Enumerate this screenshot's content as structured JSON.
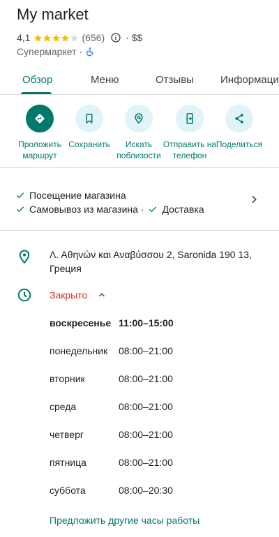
{
  "place": {
    "title": "My market",
    "rating": "4,1",
    "stars_value": 4.1,
    "stars_max": 5,
    "reviews": "(656)",
    "price": "· $$",
    "category": "Супермаркет ·"
  },
  "tabs": [
    {
      "label": "Обзор",
      "active": true
    },
    {
      "label": "Меню"
    },
    {
      "label": "Отзывы"
    },
    {
      "label": "Информация"
    }
  ],
  "actions": [
    {
      "label": "Проложить маршрут",
      "icon": "directions-icon"
    },
    {
      "label": "Сохранить",
      "icon": "bookmark-icon"
    },
    {
      "label": "Искать поблизости",
      "icon": "search-nearby-icon"
    },
    {
      "label": "Отправить на телефон",
      "icon": "send-to-phone-icon"
    },
    {
      "label": "Поделиться",
      "icon": "share-icon"
    }
  ],
  "services": {
    "line1": "Посещение магазина",
    "line2_a": "Самовывоз из магазина ·",
    "line2_b": "Доставка"
  },
  "address": "Λ. Αθηνών και Αναβύσσου 2, Saronida 190 13, Греция",
  "status": "Закрыто",
  "hours": [
    {
      "day": "воскресенье",
      "time": "11:00–15:00",
      "today": true
    },
    {
      "day": "понедельник",
      "time": "08:00–21:00"
    },
    {
      "day": "вторник",
      "time": "08:00–21:00"
    },
    {
      "day": "среда",
      "time": "08:00–21:00"
    },
    {
      "day": "четверг",
      "time": "08:00–21:00"
    },
    {
      "day": "пятница",
      "time": "08:00–21:00"
    },
    {
      "day": "суббота",
      "time": "08:00–20:30"
    }
  ],
  "suggest_hours": "Предложить другие часы работы",
  "colors": {
    "accent": "#00796b",
    "action_bg": "#dff3f8",
    "star": "#fbbc04",
    "closed": "#d93025",
    "check": "#188038"
  }
}
